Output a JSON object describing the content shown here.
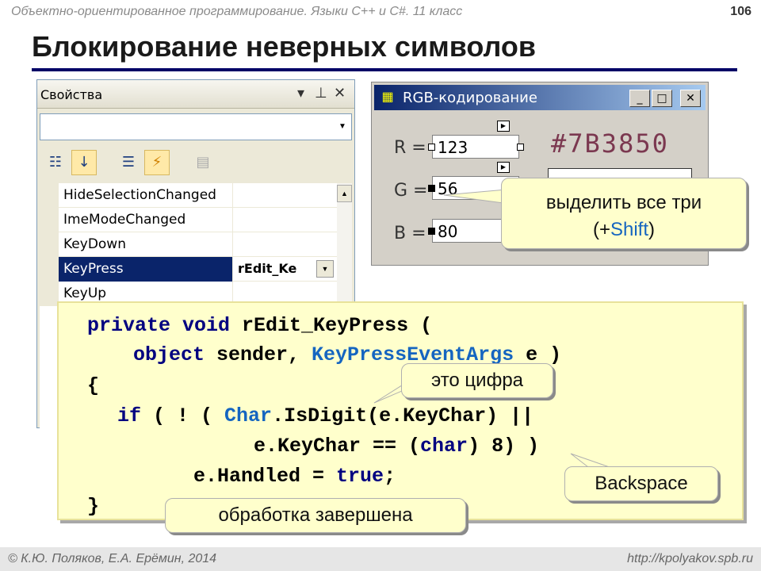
{
  "header": {
    "course": "Объектно-ориентированное программирование. Языки C++ и C#. 11 класс",
    "page_number": "106",
    "title": "Блокирование неверных символов"
  },
  "properties_panel": {
    "title": "Свойства",
    "pin_icon": "pin-icon",
    "close_icon": "close-icon",
    "rows": [
      {
        "name": "HideSelectionChanged",
        "value": ""
      },
      {
        "name": "ImeModeChanged",
        "value": ""
      },
      {
        "name": "KeyDown",
        "value": ""
      },
      {
        "name": "KeyPress",
        "value": "rEdit_Ke"
      },
      {
        "name": "KeyUp",
        "value": ""
      }
    ]
  },
  "rgb_window": {
    "title": "RGB-кодирование",
    "labels": {
      "r": "R =",
      "g": "G =",
      "b": "B ="
    },
    "values": {
      "r": "123",
      "g": "56",
      "b": "80"
    },
    "hex": "#7B3850",
    "color": "#7b3850"
  },
  "code": {
    "l1_a": "private void ",
    "l1_b": "rEdit_KeyPress",
    "l1_c": " (",
    "l2_a": "object",
    "l2_b": " sender, ",
    "l2_c": "KeyPressEventArgs",
    "l2_d": " e )",
    "l3": "{",
    "l4_a": "if",
    "l4_b": " ( ! ( ",
    "l4_c": "Char",
    "l4_d": ".IsDigit(e.KeyChar) ||",
    "l5_a": "e.KeyChar == (",
    "l5_b": "char",
    "l5_c": ") 8) )",
    "l6_a": "e.Handled",
    "l6_b": " = ",
    "l6_c": "true",
    "l6_d": ";",
    "l7": "}"
  },
  "callouts": {
    "select_three_line1": "выделить все три",
    "select_three_line2a": "(+",
    "select_three_shift": "Shift",
    "select_three_line2b": ")",
    "digit": "это цифра",
    "backspace": "Backspace",
    "handled": "обработка завершена"
  },
  "footer": {
    "authors": "© К.Ю. Поляков, Е.А. Ерёмин, 2014",
    "url": "http://kpolyakov.spb.ru"
  }
}
